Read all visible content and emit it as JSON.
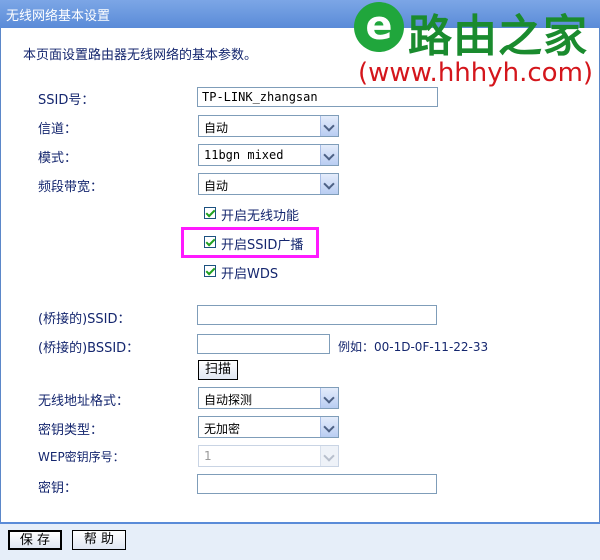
{
  "window": {
    "title": "无线网络基本设置"
  },
  "watermark": {
    "logo_letter": "e",
    "name": "路由之家",
    "url": "(www.hhhyh.com)"
  },
  "description": "本页面设置路由器无线网络的基本参数。",
  "fields": {
    "ssid": {
      "label": "SSID号：",
      "value": "TP-LINK_zhangsan"
    },
    "channel": {
      "label": "信道：",
      "value": "自动"
    },
    "mode": {
      "label": "模式：",
      "value": "11bgn mixed"
    },
    "bandwidth": {
      "label": "频段带宽：",
      "value": "自动"
    }
  },
  "checkboxes": [
    {
      "label": "开启无线功能",
      "checked": true
    },
    {
      "label": "开启SSID广播",
      "checked": true
    },
    {
      "label": "开启WDS",
      "checked": true
    }
  ],
  "wds": {
    "bridge_ssid_label": "(桥接的)SSID：",
    "bridge_ssid_value": "",
    "bridge_bssid_label": "(桥接的)BSSID：",
    "bridge_bssid_value": "",
    "example": "例如：00-1D-0F-11-22-33",
    "scan_label": "扫描",
    "addr_format_label": "无线地址格式：",
    "addr_format_value": "自动探测",
    "key_type_label": "密钥类型：",
    "key_type_value": "无加密",
    "wep_index_label": "WEP密钥序号：",
    "wep_index_value": "1",
    "key_label": "密钥：",
    "key_value": ""
  },
  "footer": {
    "save_label": "保 存",
    "help_label": "帮 助"
  },
  "colors": {
    "title_bar": "#5a8bd8",
    "text": "#14266e",
    "highlight": "#ff1aff"
  }
}
